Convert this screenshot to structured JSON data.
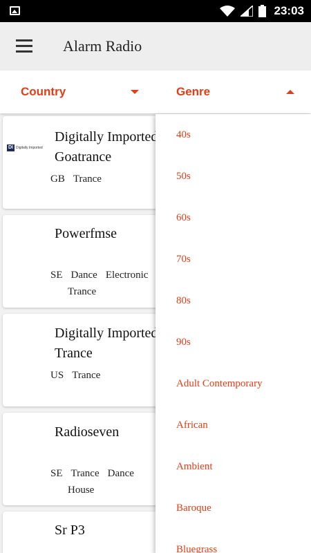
{
  "status_bar": {
    "time": "23:03",
    "icons": [
      "image-icon",
      "wifi-icon",
      "signal-icon",
      "battery-icon"
    ]
  },
  "app_bar": {
    "title": "Alarm Radio",
    "menu_icon": "hamburger-menu-icon"
  },
  "filters": {
    "country": {
      "label": "Country",
      "state": "collapsed"
    },
    "genre": {
      "label": "Genre",
      "state": "expanded"
    }
  },
  "colors": {
    "accent": "#e53c14",
    "appbar": "#eeeeee",
    "background": "#f2f2f2"
  },
  "stations": [
    {
      "name_line1": "Digitally Imported",
      "name_line2": "Goatrance",
      "country": "GB",
      "genres": [
        "Trance"
      ],
      "logo_box": "DI",
      "logo_text": "Digitally Imported"
    },
    {
      "name_line1": "Powerfmse",
      "country": "SE",
      "genres": [
        "Dance",
        "Electronic",
        "Trance"
      ]
    },
    {
      "name_line1": "Digitally Imported",
      "name_line2": "Trance",
      "country": "US",
      "genres": [
        "Trance"
      ]
    },
    {
      "name_line1": "Radioseven",
      "country": "SE",
      "genres": [
        "Trance",
        "Dance",
        "House"
      ]
    },
    {
      "name_line1": "Sr P3"
    }
  ],
  "genre_options": [
    "40s",
    "50s",
    "60s",
    "70s",
    "80s",
    "90s",
    "Adult Contemporary",
    "African",
    "Ambient",
    "Baroque",
    "Bluegrass"
  ]
}
